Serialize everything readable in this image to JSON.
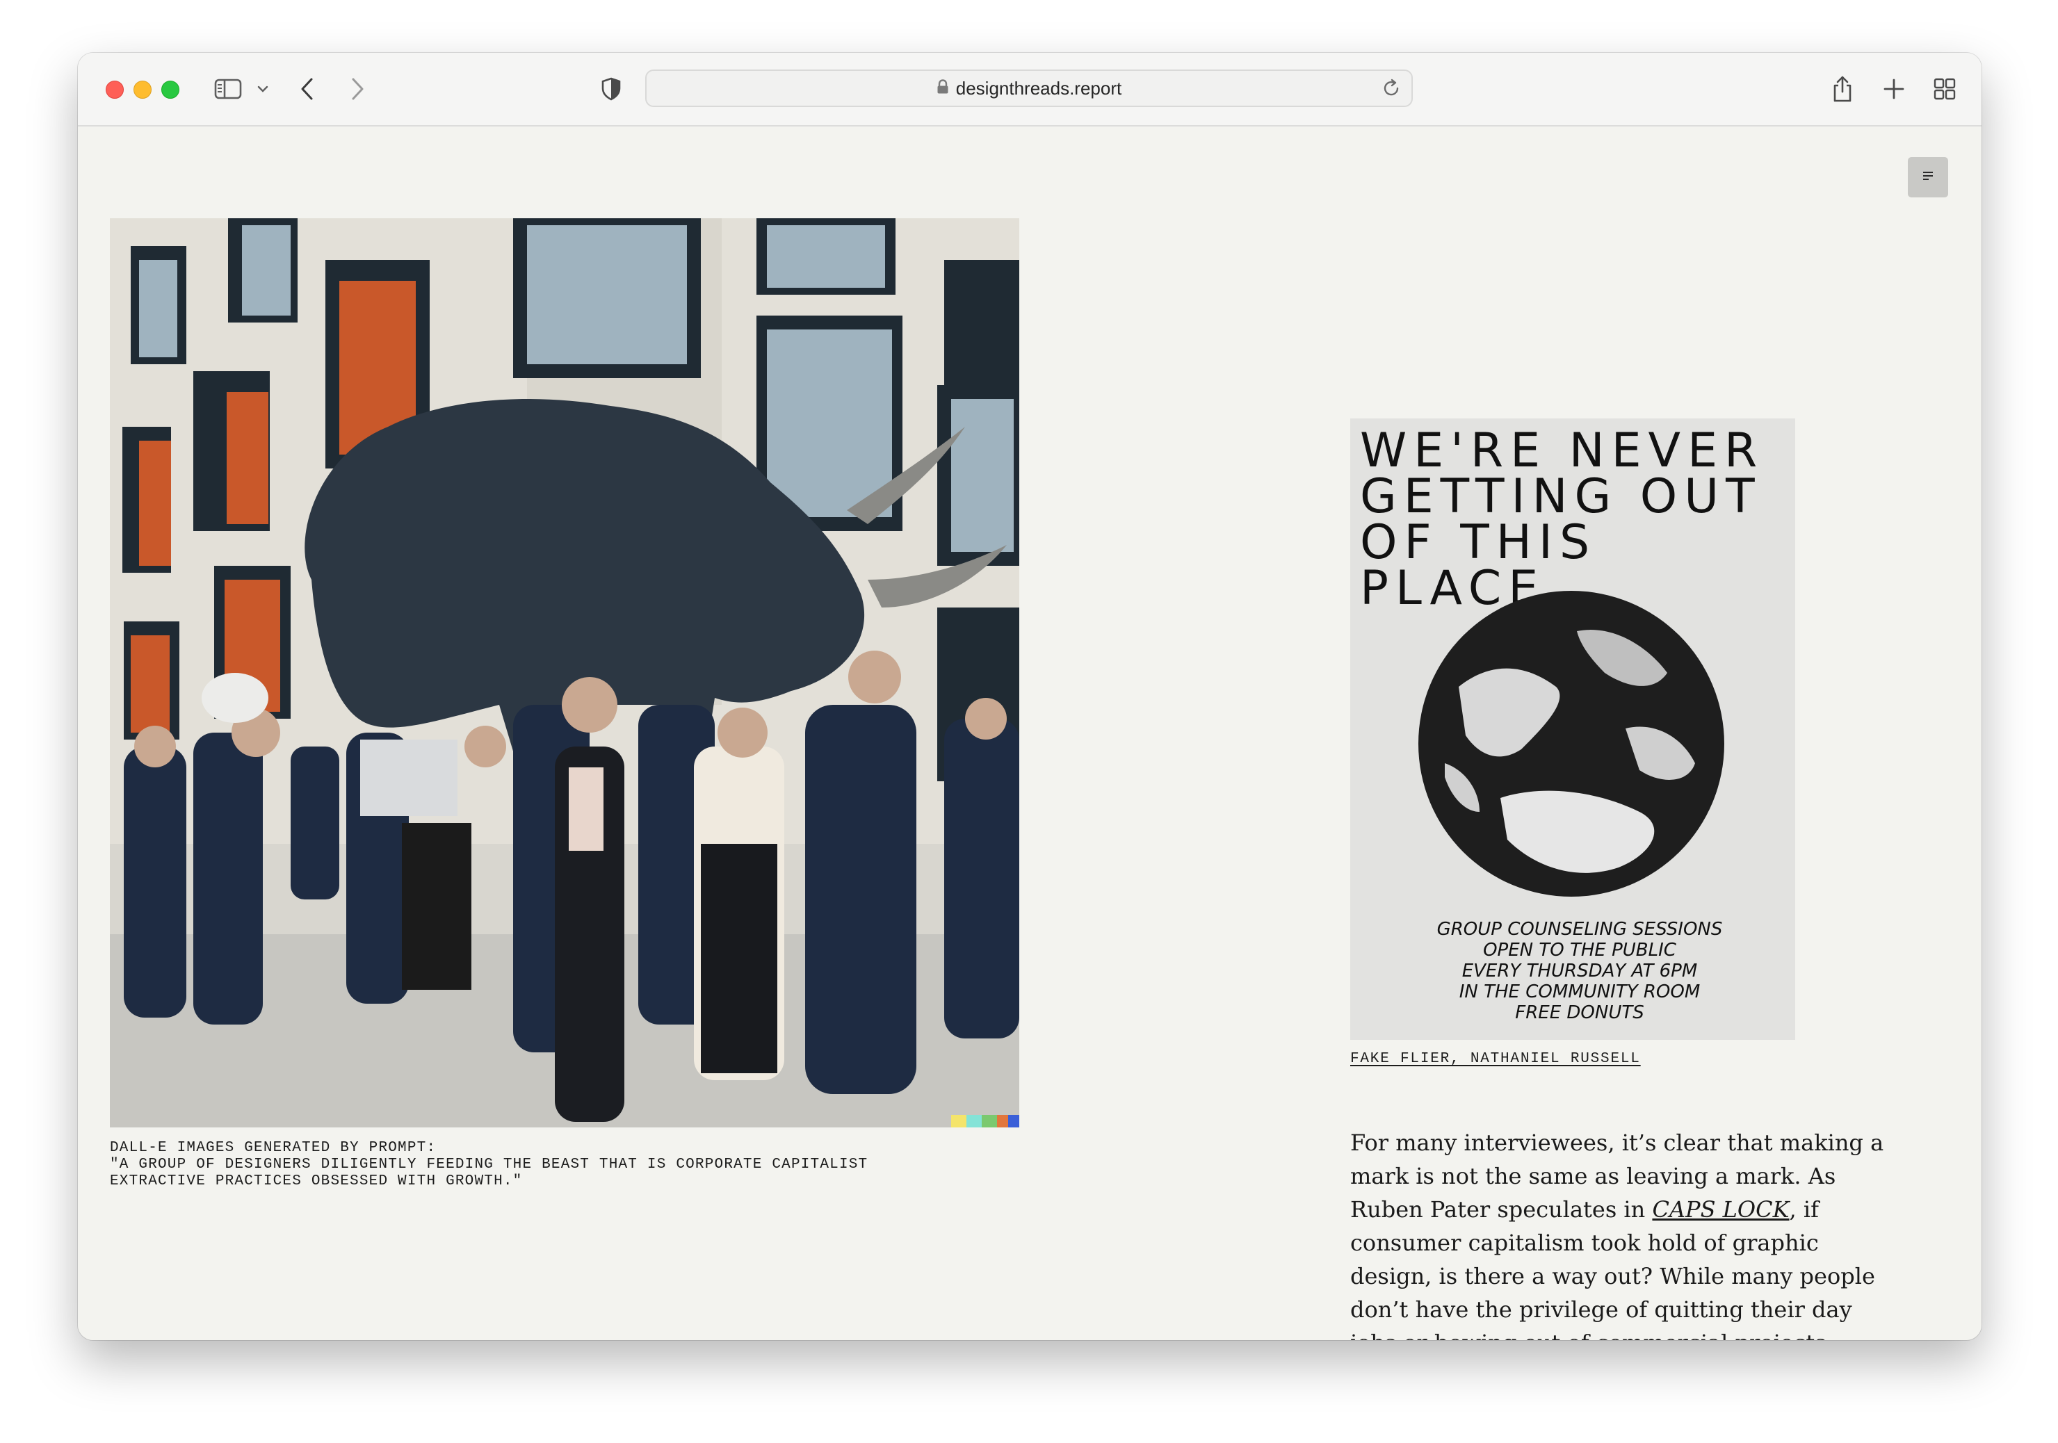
{
  "browser": {
    "url": "designthreads.report"
  },
  "left_figure": {
    "caption": "DALL-E IMAGES GENERATED BY PROMPT:\n\"A GROUP OF DESIGNERS DILIGENTLY FEEDING THE BEAST THAT IS CORPORATE CAPITALIST\nEXTRACTIVE PRACTICES OBSESSED WITH GROWTH.\""
  },
  "poster": {
    "title": "WE'RE NEVER\nGETTING OUT\nOF THIS PLACE",
    "line1": "GROUP COUNSELING SESSIONS",
    "line2": "OPEN TO THE PUBLIC",
    "line3": "EVERY THURSDAY AT 6PM",
    "line4": "IN THE COMMUNITY ROOM",
    "line5": "FREE DONUTS"
  },
  "right_figure": {
    "caption": "FAKE FLIER, NATHANIEL RUSSELL"
  },
  "article": {
    "text_before_link": "For many interviewees, it’s clear that making a mark is not the same as leaving a mark. As Ruben Pater speculates in ",
    "link_text": "CAPS LOCK",
    "text_after_link": ", if consumer capitalism took hold of graphic design, is there a way out? While many people don’t have the privilege of quitting their day jobs or bowing out of commercial projects entirely, respondents are interrogating design as a tool for consumption and"
  },
  "colors": {
    "page_bg": "#f3f3ef",
    "text": "#1a1a1a"
  }
}
